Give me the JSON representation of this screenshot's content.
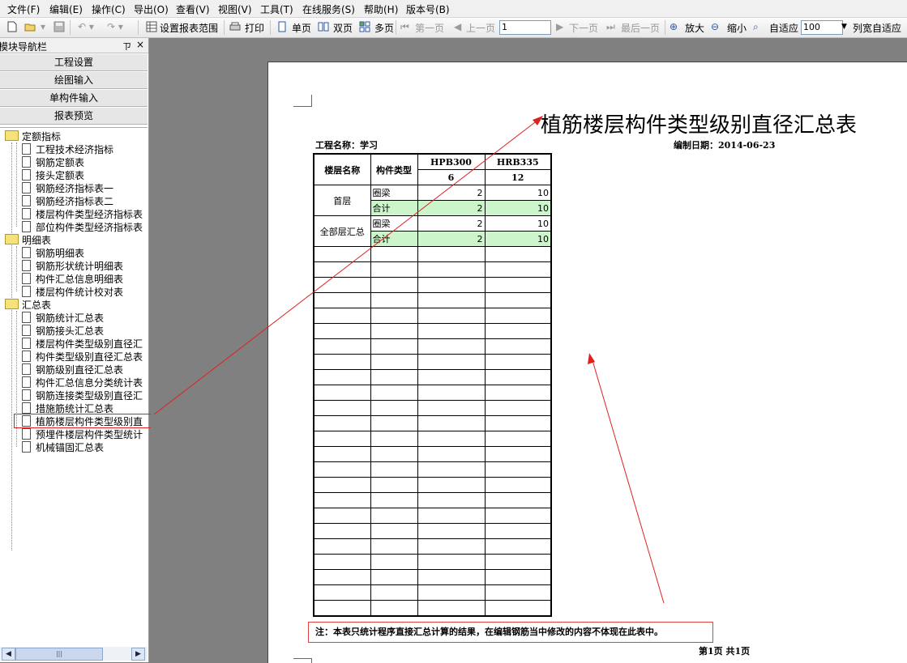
{
  "menu": [
    "文件(F)",
    "编辑(E)",
    "操作(C)",
    "导出(O)",
    "查看(V)",
    "视图(V)",
    "工具(T)",
    "在线服务(S)",
    "帮助(H)",
    "版本号(B)"
  ],
  "toolbar": {
    "set_range": "设置报表范围",
    "print": "打印",
    "single": "单页",
    "double": "双页",
    "multi": "多页",
    "first": "第一页",
    "prev": "上一页",
    "page_value": "1",
    "next": "下一页",
    "last": "最后一页",
    "zoom_in": "放大",
    "zoom_out": "缩小",
    "fit": "自适应",
    "zoom_value": "100",
    "col_fit": "列宽自适应"
  },
  "panel": {
    "title": "模块导航栏",
    "pin": "ㄗ",
    "close": "×",
    "nav_buttons": [
      "工程设置",
      "绘图输入",
      "单构件输入",
      "报表预览"
    ]
  },
  "tree": {
    "groups": [
      {
        "label": "定额指标",
        "items": [
          "工程技术经济指标",
          "钢筋定额表",
          "接头定额表",
          "钢筋经济指标表一",
          "钢筋经济指标表二",
          "楼层构件类型经济指标表",
          "部位构件类型经济指标表"
        ]
      },
      {
        "label": "明细表",
        "items": [
          "钢筋明细表",
          "钢筋形状统计明细表",
          "构件汇总信息明细表",
          "楼层构件统计校对表"
        ]
      },
      {
        "label": "汇总表",
        "items": [
          "钢筋统计汇总表",
          "钢筋接头汇总表",
          "楼层构件类型级别直径汇",
          "构件类型级别直径汇总表",
          "钢筋级别直径汇总表",
          "构件汇总信息分类统计表",
          "钢筋连接类型级别直径汇",
          "措施筋统计汇总表",
          "植筋楼层构件类型级别直",
          "预埋件楼层构件类型统计",
          "机械锚固汇总表"
        ]
      }
    ]
  },
  "report": {
    "title": "植筋楼层构件类型级别直径汇总表",
    "project": "工程名称：学习",
    "date": "编制日期：2014-06-23",
    "headers": {
      "floor": "楼层名称",
      "type": "构件类型",
      "hpb": "HPB300",
      "hrb": "HRB335",
      "hpb_dia": "6",
      "hrb_dia": "12"
    },
    "rows": [
      {
        "floor": "首层",
        "items": [
          {
            "type": "圈梁",
            "hpb": "2",
            "hrb": "10",
            "sum": false
          },
          {
            "type": "合计",
            "hpb": "2",
            "hrb": "10",
            "sum": true
          }
        ]
      },
      {
        "floor": "全部层汇总",
        "items": [
          {
            "type": "圈梁",
            "hpb": "2",
            "hrb": "10",
            "sum": false
          },
          {
            "type": "合计",
            "hpb": "2",
            "hrb": "10",
            "sum": true
          }
        ]
      }
    ],
    "note": "注：本表只统计程序直接汇总计算的结果，在编辑钢筋当中修改的内容不体现在此表中。",
    "page_info": "第1页 共1页"
  }
}
